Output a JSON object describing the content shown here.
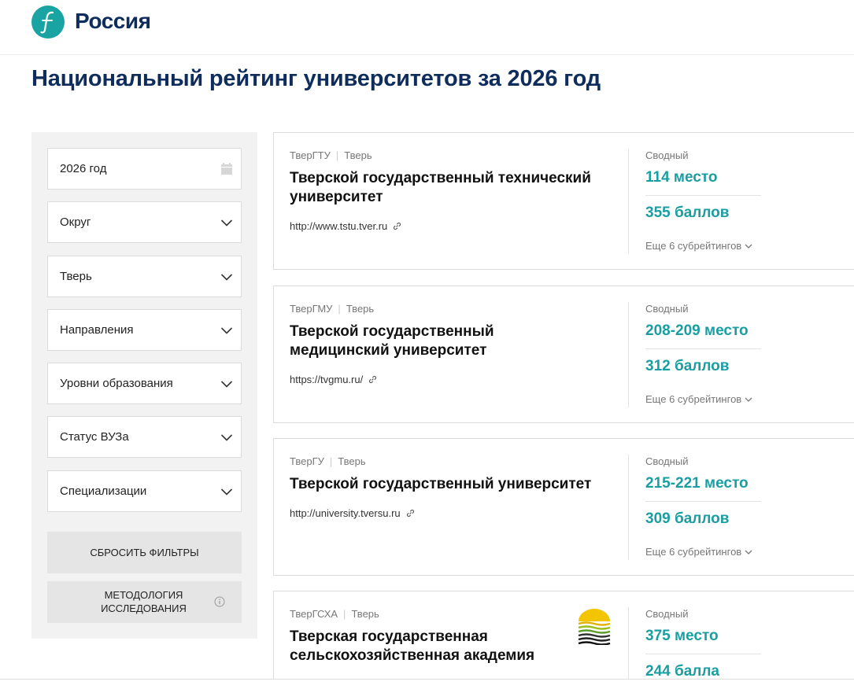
{
  "header": {
    "logo_letter": "f",
    "site_name": "Россия"
  },
  "page_title": "Национальный рейтинг университетов за 2026 год",
  "filters": {
    "year": "2026 год",
    "items": [
      "Округ",
      "Тверь",
      "Направления",
      "Уровни образования",
      "Статус ВУЗа",
      "Специализации"
    ],
    "reset_label": "СБРОСИТЬ ФИЛЬТРЫ",
    "methodology_label": "МЕТОДОЛОГИЯ ИССЛЕДОВАНИЯ"
  },
  "universities": [
    {
      "abbr": "ТверГТУ",
      "city": "Тверь",
      "name": "Тверской государственный технический университет",
      "url": "http://www.tstu.tver.ru",
      "rating_label": "Сводный",
      "place": "114 место",
      "score": "355 баллов",
      "more": "Еще 6 субрейтингов"
    },
    {
      "abbr": "ТверГМУ",
      "city": "Тверь",
      "name": "Тверской государственный медицинский университет",
      "url": "https://tvgmu.ru/",
      "rating_label": "Сводный",
      "place": "208-209 место",
      "score": "312 баллов",
      "more": "Еще 6 субрейтингов"
    },
    {
      "abbr": "ТверГУ",
      "city": "Тверь",
      "name": "Тверской государственный университет",
      "url": "http://university.tversu.ru",
      "rating_label": "Сводный",
      "place": "215-221 место",
      "score": "309 баллов",
      "more": "Еще 6 субрейтингов"
    },
    {
      "abbr": "ТверГСХА",
      "city": "Тверь",
      "name": "Тверская государственная сельскохозяйственная академия",
      "url": "",
      "rating_label": "Сводный",
      "place": "375 место",
      "score": "244 балла",
      "more": ""
    }
  ],
  "colors": {
    "brand_navy": "#0f2d5c",
    "accent_teal": "#1a9ea1",
    "logo_teal": "#1aa3a3",
    "sidebar_bg": "#f2f2f2"
  }
}
